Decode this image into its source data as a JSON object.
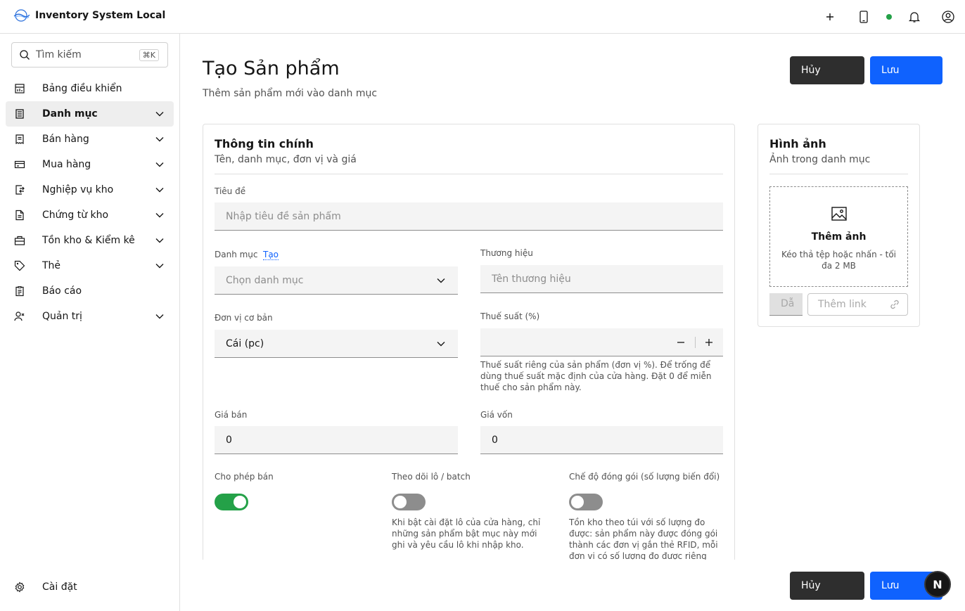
{
  "app": {
    "title": "Inventory System Local",
    "logo_text": ""
  },
  "header": {
    "icons": [
      "add-icon",
      "tablet-icon",
      "status-dot",
      "notification-icon",
      "user-avatar-icon"
    ],
    "status_color": "#24a148"
  },
  "search": {
    "placeholder": "Tìm kiếm",
    "shortcut": "⌘K"
  },
  "sidebar": {
    "items": [
      {
        "label": "Bảng điều khiển",
        "icon": "dashboard-icon",
        "expandable": false,
        "active": false
      },
      {
        "label": "Danh mục",
        "icon": "catalog-icon",
        "expandable": true,
        "active": true
      },
      {
        "label": "Bán hàng",
        "icon": "sales-icon",
        "expandable": true,
        "active": false
      },
      {
        "label": "Mua hàng",
        "icon": "purchase-icon",
        "expandable": true,
        "active": false
      },
      {
        "label": "Nghiệp vụ kho",
        "icon": "warehouse-ops-icon",
        "expandable": true,
        "active": false
      },
      {
        "label": "Chứng từ kho",
        "icon": "document-icon",
        "expandable": true,
        "active": false
      },
      {
        "label": "Tồn kho & Kiểm kê",
        "icon": "stock-icon",
        "expandable": true,
        "active": false
      },
      {
        "label": "Thẻ",
        "icon": "tag-icon",
        "expandable": true,
        "active": false
      },
      {
        "label": "Báo cáo",
        "icon": "report-icon",
        "expandable": false,
        "active": false
      },
      {
        "label": "Quản trị",
        "icon": "admin-icon",
        "expandable": true,
        "active": false
      }
    ],
    "settings_label": "Cài đặt"
  },
  "page": {
    "title": "Tạo Sản phẩm",
    "subtitle": "Thêm sản phẩm mới vào danh mục",
    "cancel_label": "Hủy",
    "save_label": "Lưu"
  },
  "main_card": {
    "title": "Thông tin chính",
    "subtitle": "Tên, danh mục, đơn vị và giá",
    "title_label": "Tiêu đề",
    "title_placeholder": "Nhập tiêu đề sản phẩm",
    "category_label": "Danh mục",
    "category_create": "Tạo",
    "category_placeholder": "Chọn danh mục",
    "brand_label": "Thương hiệu",
    "brand_placeholder": "Tên thương hiệu",
    "unit_label": "Đơn vị cơ bản",
    "unit_value": "Cái (pc)",
    "tax_label": "Thuế suất (%)",
    "tax_value": "",
    "tax_helper": "Thuế suất riêng của sản phẩm (đơn vị %). Để trống để dùng thuế suất mặc định của cửa hàng. Đặt 0 để miễn thuế cho sản phẩm này.",
    "price_label": "Giá bán",
    "price_value": "0",
    "cost_label": "Giá vốn",
    "cost_value": "0",
    "toggles": [
      {
        "label": "Cho phép bán",
        "on": true,
        "helper": ""
      },
      {
        "label": "Theo dõi lô / batch",
        "on": false,
        "helper": "Khi bật cài đặt lô của cửa hàng, chỉ những sản phẩm bật mục này mới ghi và yêu cầu lô khi nhập kho."
      },
      {
        "label": "Chế độ đóng gói (số lượng biến đổi)",
        "on": false,
        "helper": "Tồn kho theo túi với số lượng đo được: sản phẩm này được đóng gói thành các đơn vị gắn thẻ RFID, mỗi đơn vị có số lượng đo được riêng theo đơn vị của"
      }
    ]
  },
  "image_card": {
    "title": "Hình ảnh",
    "subtitle": "Ảnh trong danh mục",
    "add_title": "Thêm ảnh",
    "add_help": "Kéo thả tệp hoặc nhấn - tối đa 2 MB",
    "small_input_value": "Dẫ",
    "link_placeholder": "Thêm link"
  },
  "assistant_badge": "N"
}
